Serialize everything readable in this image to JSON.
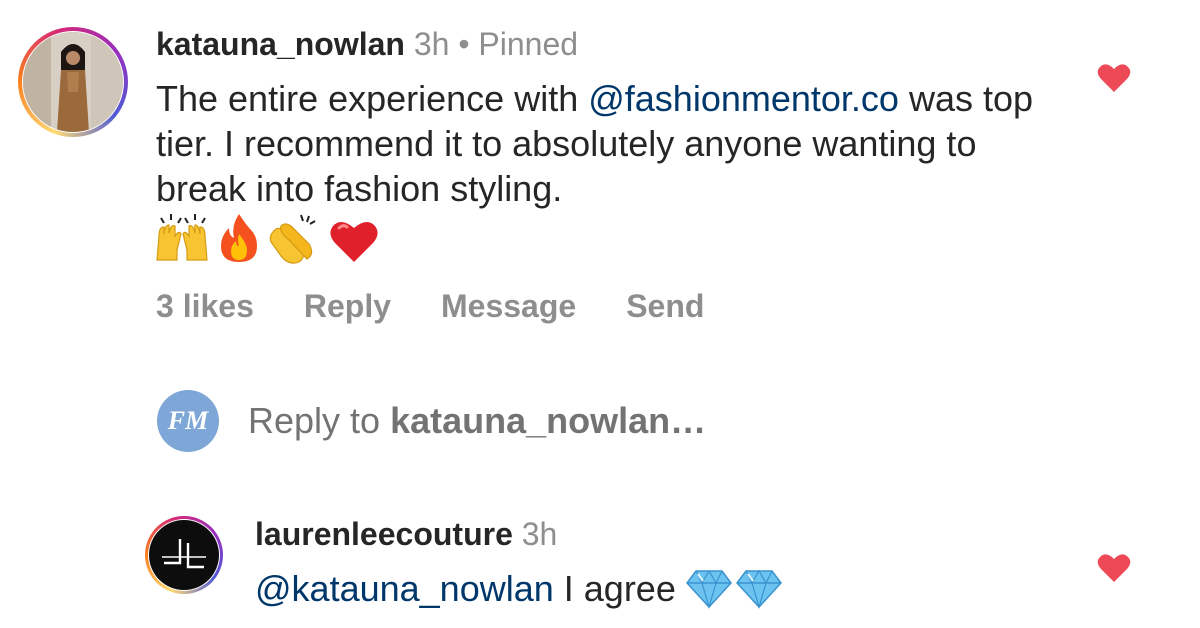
{
  "comment1": {
    "username": "katauna_nowlan",
    "time": "3h",
    "separator": "•",
    "pinned_label": "Pinned",
    "text_before_mention": "The entire experience with ",
    "mention": "@fashionmentor.co",
    "text_after_mention": " was top tier. I recommend it to absolutely anyone wanting to break into fashion styling.",
    "emojis": [
      "raising-hands",
      "fire",
      "clapping-hands",
      "red-heart"
    ],
    "likes_label": "3 likes",
    "reply_label": "Reply",
    "message_label": "Message",
    "send_label": "Send",
    "liked": true
  },
  "reply_prompt": {
    "avatar_initials": "FM",
    "prefix": "Reply to ",
    "target_username": "katauna_nowlan…"
  },
  "comment2": {
    "username": "laurenleecouture",
    "time": "3h",
    "mention": "@katauna_nowlan",
    "text": " I agree",
    "emojis": [
      "gem-stone",
      "gem-stone"
    ],
    "liked": true
  },
  "colors": {
    "text": "#262626",
    "meta": "#8e8e8e",
    "mention": "#00376b",
    "heart": "#ed4956",
    "fm_avatar": "#7ea6d6"
  }
}
